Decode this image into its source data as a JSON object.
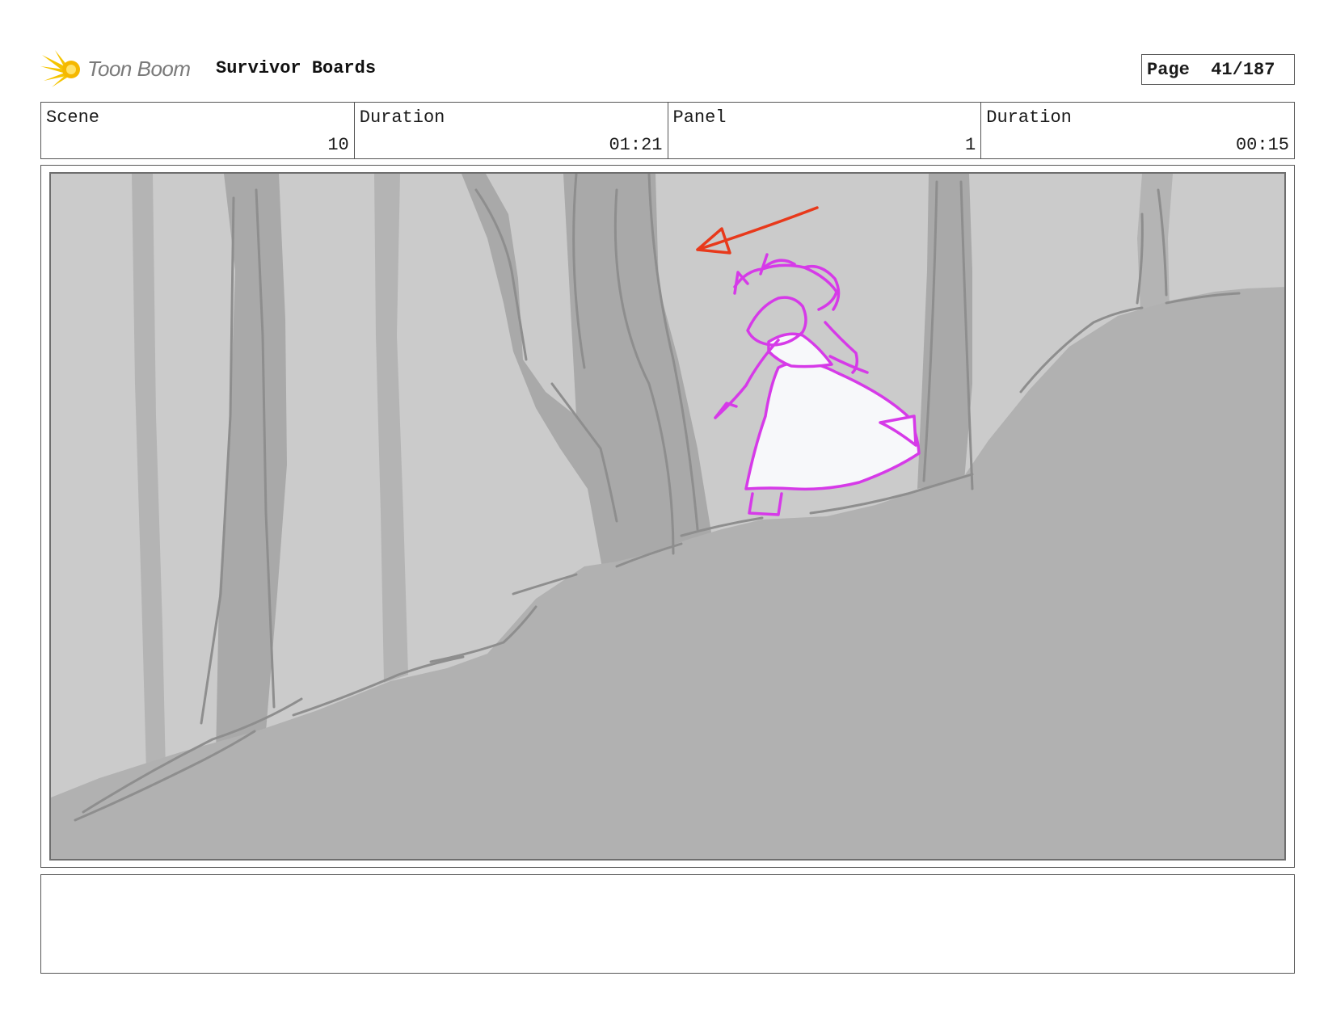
{
  "header": {
    "logo_text": "Toon Boom",
    "project_title": "Survivor Boards",
    "page_label": "Page",
    "page_value": "41/187"
  },
  "info": {
    "scene_label": "Scene",
    "scene_value": "10",
    "scene_duration_label": "Duration",
    "scene_duration_value": "01:21",
    "panel_label": "Panel",
    "panel_value": "1",
    "panel_duration_label": "Duration",
    "panel_duration_value": "00:15"
  },
  "panel": {
    "colors": {
      "background": "#cbcbcb",
      "trees": "#a9a9a9",
      "ground": "#b1b1b1",
      "character": "#d63ae8",
      "arrow": "#e8391b"
    },
    "icons": [
      "toon-boom-logo-icon",
      "direction-arrow-icon"
    ]
  },
  "notes": {
    "text": ""
  }
}
